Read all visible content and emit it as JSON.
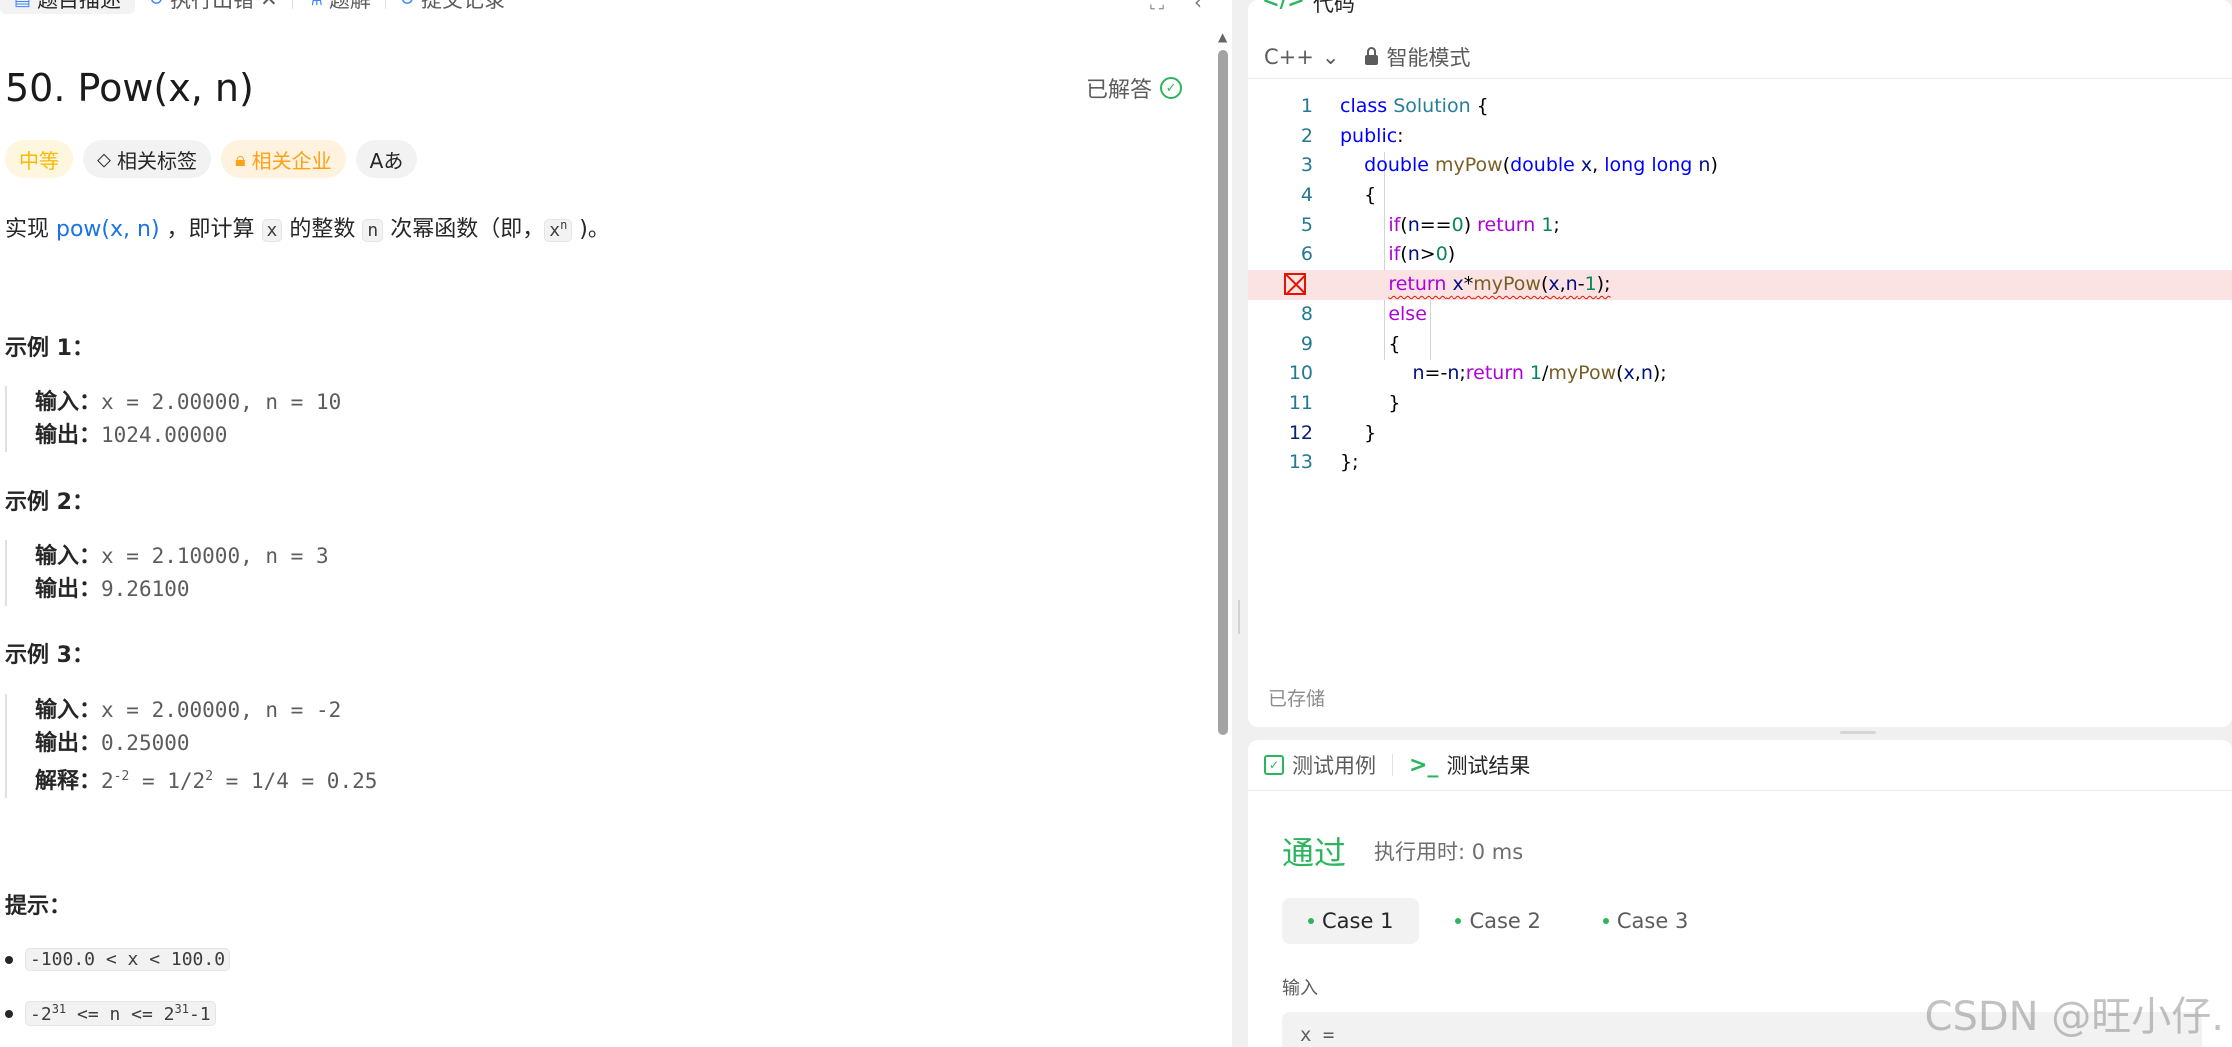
{
  "left_tabs": [
    {
      "label": "题目描述",
      "icon": "description-icon"
    },
    {
      "label": "执行出错",
      "icon": "history-icon",
      "close": "✕"
    },
    {
      "label": "题解",
      "icon": "solution-icon"
    },
    {
      "label": "提交记录",
      "icon": "history-icon"
    }
  ],
  "problem": {
    "title": "50. Pow(x, n)",
    "solved_label": "已解答",
    "tags": {
      "difficulty": "中等",
      "related_tags": "相关标签",
      "companies": "相关企业",
      "translate": "Aあ"
    },
    "description": {
      "p1": "实现 ",
      "link": "pow(x, n)",
      "p2": " ，即计算 ",
      "code1": "x",
      "p3": " 的整数 ",
      "code2": "n",
      "p4": " 次幂函数（即，",
      "code3": "x",
      "code3_sup": "n",
      "p5": " )。"
    },
    "examples": [
      {
        "title": "示例 1：",
        "input_label": "输入：",
        "input": "x = 2.00000, n = 10",
        "output_label": "输出：",
        "output": "1024.00000"
      },
      {
        "title": "示例 2：",
        "input_label": "输入：",
        "input": "x = 2.10000, n = 3",
        "output_label": "输出：",
        "output": "9.26100"
      },
      {
        "title": "示例 3：",
        "input_label": "输入：",
        "input": "x = 2.00000, n = -2",
        "output_label": "输出：",
        "output": "0.25000",
        "explain_label": "解释：",
        "explain": {
          "a": "2",
          "a_sup": "-2",
          "b": " = 1/2",
          "b_sup": "2",
          "c": " = 1/4 = 0.25"
        }
      }
    ],
    "hints_title": "提示：",
    "hints": [
      {
        "text": "-100.0 < x < 100.0"
      },
      {
        "a": "-2",
        "a_sup": "31",
        "b": " <= n <= 2",
        "b_sup": "31",
        "c": "-1"
      }
    ]
  },
  "editor": {
    "title": "代码",
    "language": "C++",
    "mode": "智能模式",
    "saved": "已存储",
    "line_numbers": [
      "1",
      "2",
      "3",
      "4",
      "5",
      "6",
      "7",
      "8",
      "9",
      "10",
      "11",
      "12",
      "13"
    ]
  },
  "tests": {
    "tab_cases": "测试用例",
    "tab_result": "测试结果",
    "status": "通过",
    "runtime": "执行用时: 0 ms",
    "cases": [
      "Case 1",
      "Case 2",
      "Case 3"
    ],
    "input_label": "输入",
    "input_value": "x ="
  },
  "watermark": "CSDN @旺小仔.",
  "colors": {
    "accent_green": "#2db55d",
    "difficulty": "#ffb800",
    "link": "#1a73e8",
    "error": "#e51400"
  }
}
